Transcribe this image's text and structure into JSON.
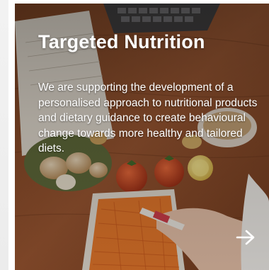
{
  "card": {
    "title": "Targeted Nutrition",
    "description": "We are supporting the development of a personalised approach to nutritional products and dietary guidance to create behavioural change towards more healthy and tailored diets.",
    "arrow_icon": "arrow-right-icon"
  },
  "colors": {
    "text": "#ffffff",
    "wood": "#8b4a26",
    "tomato": "#c9401f",
    "carrot": "#e8782a"
  }
}
